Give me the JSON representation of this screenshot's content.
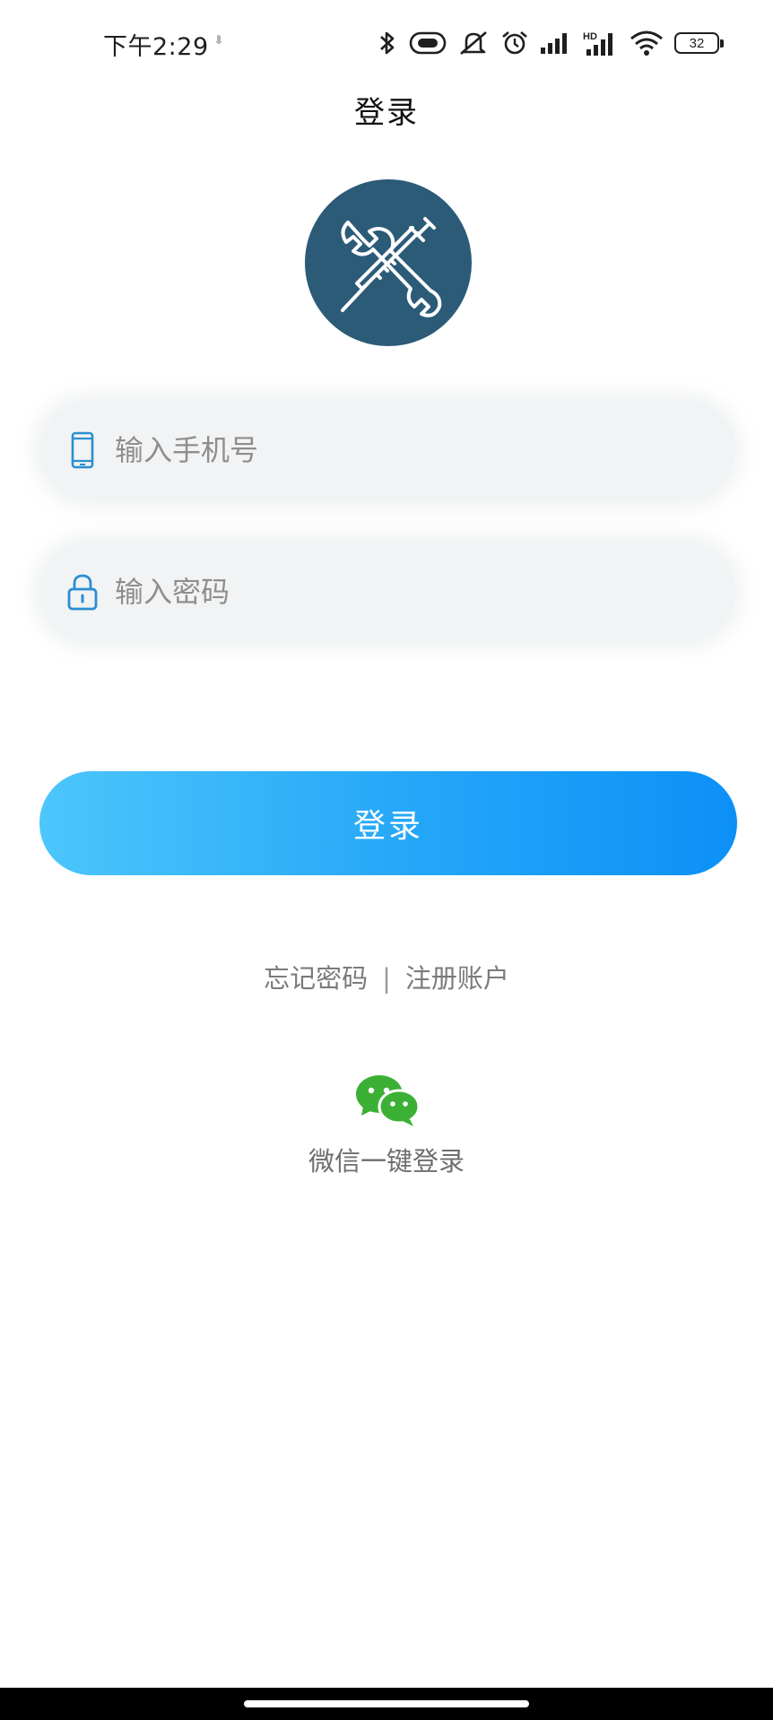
{
  "status_bar": {
    "time": "下午2:29",
    "network_label": "HD",
    "battery_level": "32",
    "icons": [
      "bluetooth-icon",
      "nfc-icon",
      "mute-icon",
      "alarm-icon",
      "signal-icon",
      "hd-signal-icon",
      "wifi-icon",
      "battery-icon"
    ]
  },
  "header": {
    "title": "登录"
  },
  "logo": {
    "icon": "wrench-syringe-icon",
    "background": "#2c5b78"
  },
  "form": {
    "phone_placeholder": "输入手机号",
    "phone_value": "",
    "password_placeholder": "输入密码",
    "password_value": "",
    "submit_label": "登录"
  },
  "links": {
    "forgot_password": "忘记密码",
    "separator": "|",
    "register": "注册账户"
  },
  "wechat": {
    "label": "微信一键登录",
    "icon": "wechat-icon",
    "color": "#3cb034"
  },
  "colors": {
    "accent_start": "#4cc6fb",
    "accent_end": "#0c90f7",
    "field_bg": "#f1f3f4",
    "field_icon": "#2a8fd0"
  }
}
